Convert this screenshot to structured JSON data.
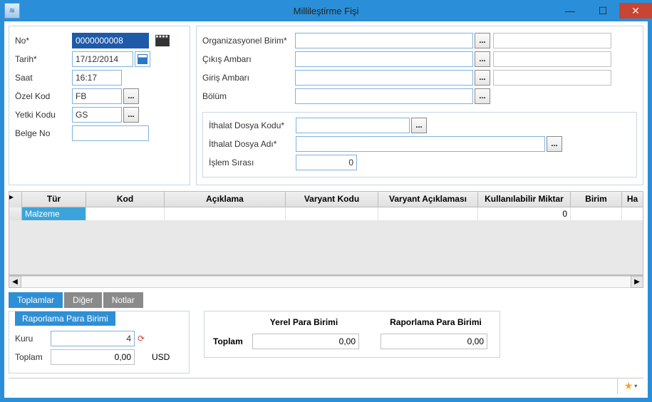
{
  "window": {
    "title": "Millileştirme Fişi"
  },
  "left": {
    "no_label": "No*",
    "no_value": "0000000008",
    "tarih_label": "Tarih*",
    "tarih_value": "17/12/2014",
    "saat_label": "Saat",
    "saat_value": "16:17",
    "ozelkod_label": "Özel Kod",
    "ozelkod_value": "FB",
    "yetkikodu_label": "Yetki Kodu",
    "yetkikodu_value": "GS",
    "belgeno_label": "Belge No",
    "belgeno_value": ""
  },
  "right": {
    "org_label": "Organizasyonel Birim*",
    "org_value": "",
    "cikis_label": "Çıkış Ambarı",
    "cikis_value": "",
    "giris_label": "Giriş Ambarı",
    "giris_value": "",
    "bolum_label": "Bölüm",
    "bolum_value": "",
    "ith_kodu_label": "İthalat Dosya Kodu*",
    "ith_kodu_value": "",
    "ith_adi_label": "İthalat Dosya Adı*",
    "ith_adi_value": "",
    "islem_label": "İşlem Sırası",
    "islem_value": "0"
  },
  "grid": {
    "columns": [
      "Tür",
      "Kod",
      "Açıklama",
      "Varyant Kodu",
      "Varyant Açıklaması",
      "Kullanılabilir Miktar",
      "Birim",
      "Ha"
    ],
    "row": {
      "tur": "Malzeme",
      "kod": "",
      "aciklama": "",
      "varyant_kodu": "",
      "varyant_aciklamasi": "",
      "kullanilabilir_miktar": "0",
      "birim": "",
      "ha": ""
    }
  },
  "tabs": {
    "t1": "Toplamlar",
    "t2": "Diğer",
    "t3": "Notlar"
  },
  "totals": {
    "subtab": "Raporlama Para Birimi",
    "kuru_label": "Kuru",
    "kuru_value": "4",
    "toplam_label": "Toplam",
    "toplam_value": "0,00",
    "currency": "USD",
    "right_col1": "Yerel Para Birimi",
    "right_col2": "Raporlama Para Birimi",
    "right_row_label": "Toplam",
    "right_val1": "0,00",
    "right_val2": "0,00"
  },
  "lookup_ellipsis": "..."
}
